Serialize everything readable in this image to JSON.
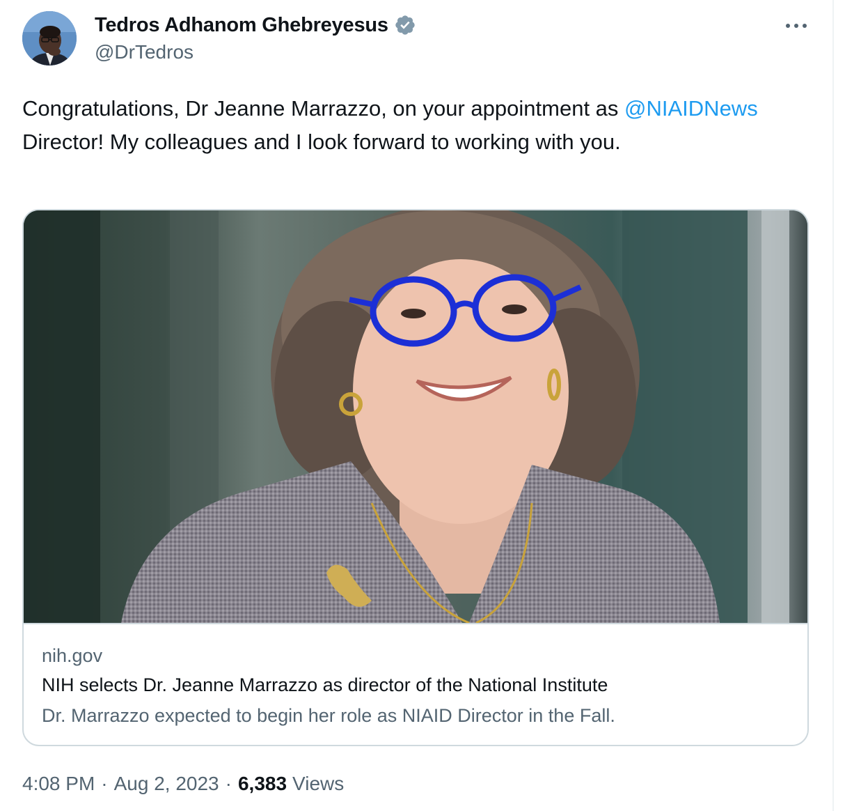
{
  "author": {
    "display_name": "Tedros Adhanom Ghebreyesus",
    "handle": "@DrTedros",
    "verified_color": "#829aab"
  },
  "tweet": {
    "text_part1": "Congratulations, Dr Jeanne Marrazzo, on your appointment as ",
    "mention": "@NIAIDNews",
    "text_part2": " Director! My colleagues and I look forward to working with you."
  },
  "link_card": {
    "domain": "nih.gov",
    "title": "NIH selects Dr. Jeanne Marrazzo as director of the National Institute",
    "description": "Dr. Marrazzo expected to begin her role as NIAID Director in the Fall."
  },
  "meta": {
    "time": "4:08 PM",
    "separator": "·",
    "date": "Aug 2, 2023",
    "views_count": "6,383",
    "views_label": "Views"
  },
  "colors": {
    "link": "#1d9bf0",
    "secondary_text": "#536471",
    "primary_text": "#0f1419",
    "border": "#cfd9de"
  },
  "icons": {
    "verified": "verified-badge-icon",
    "more": "more-horizontal-icon"
  }
}
